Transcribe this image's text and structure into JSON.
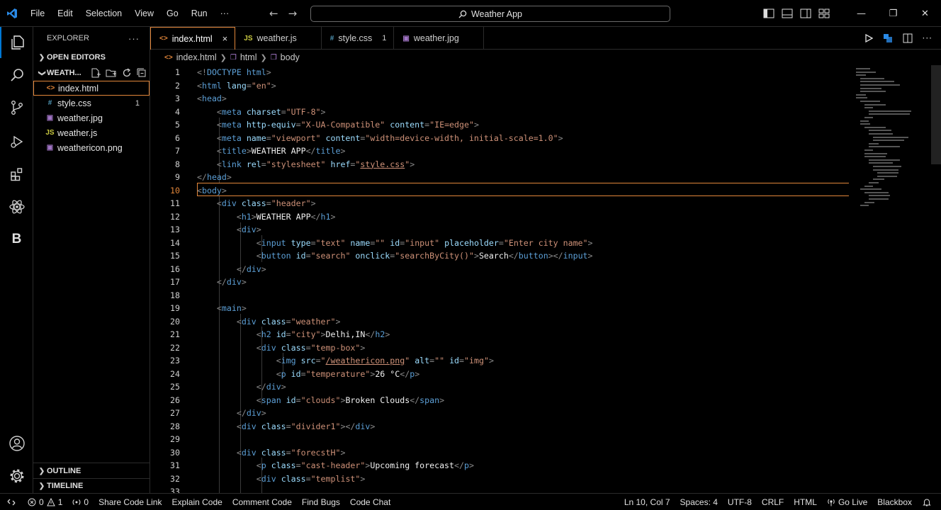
{
  "titlebar": {
    "menu": [
      "File",
      "Edit",
      "Selection",
      "View",
      "Go",
      "Run",
      "···"
    ],
    "search": "Weather App"
  },
  "sidebar": {
    "title": "EXPLORER",
    "open_editors": "OPEN EDITORS",
    "folder": "WEATH...",
    "files": [
      {
        "name": "index.html",
        "icon": "<>",
        "color": "#e2863a",
        "badge": ""
      },
      {
        "name": "style.css",
        "icon": "#",
        "color": "#519aba",
        "badge": "1"
      },
      {
        "name": "weather.jpg",
        "icon": "▣",
        "color": "#a074c4",
        "badge": ""
      },
      {
        "name": "weather.js",
        "icon": "JS",
        "color": "#cbcb41",
        "badge": ""
      },
      {
        "name": "weathericon.png",
        "icon": "▣",
        "color": "#a074c4",
        "badge": ""
      }
    ],
    "outline": "OUTLINE",
    "timeline": "TIMELINE"
  },
  "tabs": [
    {
      "label": "index.html",
      "icon": "<>",
      "color": "#e2863a",
      "active": true,
      "mark": "×"
    },
    {
      "label": "weather.js",
      "icon": "JS",
      "color": "#cbcb41",
      "active": false,
      "mark": ""
    },
    {
      "label": "style.css",
      "icon": "#",
      "color": "#519aba",
      "active": false,
      "mark": "1"
    },
    {
      "label": "weather.jpg",
      "icon": "▣",
      "color": "#a074c4",
      "active": false,
      "mark": ""
    }
  ],
  "breadcrumb": [
    "index.html",
    "html",
    "body"
  ],
  "editor": {
    "current_line": 10,
    "lines": [
      {
        "n": "1",
        "code": "<!DOCTYPE html>"
      },
      {
        "n": "2",
        "code": "<html lang=\"en\">"
      },
      {
        "n": "3",
        "code": "<head>"
      },
      {
        "n": "4",
        "code": "    <meta charset=\"UTF-8\">"
      },
      {
        "n": "5",
        "code": "    <meta http-equiv=\"X-UA-Compatible\" content=\"IE=edge\">"
      },
      {
        "n": "6",
        "code": "    <meta name=\"viewport\" content=\"width=device-width, initial-scale=1.0\">"
      },
      {
        "n": "7",
        "code": "    <title>WEATHER APP</title>"
      },
      {
        "n": "8",
        "code": "    <link rel=\"stylesheet\" href=\"style.css\">"
      },
      {
        "n": "9",
        "code": "</head>"
      },
      {
        "n": "10",
        "code": "<body>"
      },
      {
        "n": "11",
        "code": "    <div class=\"header\">"
      },
      {
        "n": "12",
        "code": "        <h1>WEATHER APP</h1>"
      },
      {
        "n": "13",
        "code": "        <div>"
      },
      {
        "n": "14",
        "code": "            <input type=\"text\" name=\"\" id=\"input\" placeholder=\"Enter city name\">"
      },
      {
        "n": "15",
        "code": "            <button id=\"search\" onclick=\"searchByCity()\">Search</button></input>"
      },
      {
        "n": "16",
        "code": "        </div>"
      },
      {
        "n": "17",
        "code": "    </div>"
      },
      {
        "n": "18",
        "code": ""
      },
      {
        "n": "19",
        "code": "    <main>"
      },
      {
        "n": "20",
        "code": "        <div class=\"weather\">"
      },
      {
        "n": "21",
        "code": "            <h2 id=\"city\">Delhi,IN</h2>"
      },
      {
        "n": "22",
        "code": "            <div class=\"temp-box\">"
      },
      {
        "n": "23",
        "code": "                <img src=\"/weathericon.png\" alt=\"\" id=\"img\">"
      },
      {
        "n": "24",
        "code": "                <p id=\"temperature\">26 °C</p>"
      },
      {
        "n": "25",
        "code": "            </div>"
      },
      {
        "n": "26",
        "code": "            <span id=\"clouds\">Broken Clouds</span>"
      },
      {
        "n": "27",
        "code": "        </div>"
      },
      {
        "n": "28",
        "code": "        <div class=\"divider1\"></div>"
      },
      {
        "n": "29",
        "code": ""
      },
      {
        "n": "30",
        "code": "        <div class=\"forecstH\">"
      },
      {
        "n": "31",
        "code": "            <p class=\"cast-header\">Upcoming forecast</p>"
      },
      {
        "n": "32",
        "code": "            <div class=\"templist\">"
      },
      {
        "n": "33",
        "code": ""
      }
    ]
  },
  "statusbar": {
    "errors": "0",
    "warnings": "1",
    "ports": "0",
    "left_items": [
      "Share Code Link",
      "Explain Code",
      "Comment Code",
      "Find Bugs",
      "Code Chat"
    ],
    "position": "Ln 10, Col 7",
    "spaces": "Spaces: 4",
    "encoding": "UTF-8",
    "eol": "CRLF",
    "language": "HTML",
    "golive": "Go Live",
    "blackbox": "Blackbox"
  }
}
